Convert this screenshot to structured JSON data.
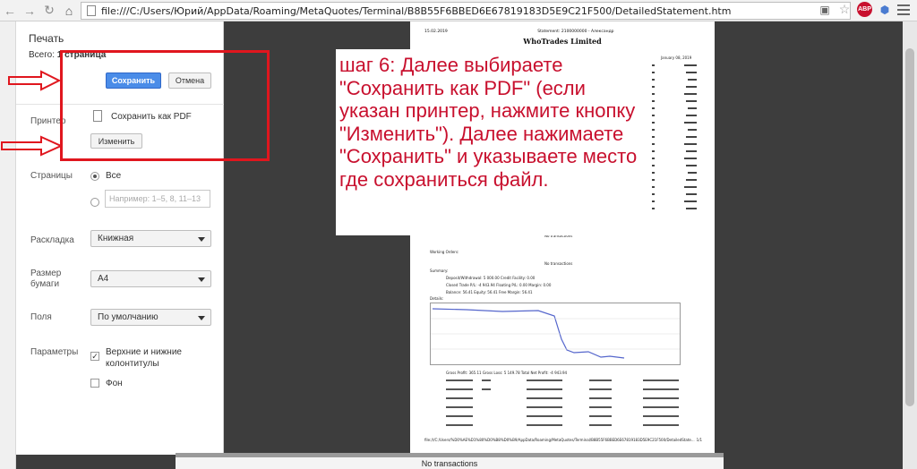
{
  "browser": {
    "url": "file:///C:/Users/Юрий/AppData/Roaming/MetaQuotes/Terminal/B8B55F6BBED6E67819183D5E9C21F500/DetailedStatement.htm",
    "extension_badge": "ABP"
  },
  "print_panel": {
    "title": "Печать",
    "total_label": "Всего:",
    "total_value": "1 страница",
    "save_label": "Сохранить",
    "cancel_label": "Отмена",
    "printer_label": "Принтер",
    "printer_name": "Сохранить как PDF",
    "change_label": "Изменить",
    "pages_label": "Страницы",
    "pages_all": "Все",
    "pages_placeholder": "Например: 1–5, 8, 11–13",
    "layout_label": "Раскладка",
    "layout_value": "Книжная",
    "paper_label_1": "Размер",
    "paper_label_2": "бумаги",
    "paper_value": "A4",
    "margins_label": "Поля",
    "margins_value": "По умолчанию",
    "params_label": "Параметры",
    "headers_label_1": "Верхние и нижние",
    "headers_label_2": "колонтитулы",
    "background_label": "Фон"
  },
  "document": {
    "date_left": "15.02.2019",
    "statement_line": "Statement: 2100000000 - Александр",
    "title": "WhoTrades Limited",
    "date_right": "January 08, 2019",
    "no_transactions_1": "No transactions",
    "working_orders": "Working Orders:",
    "no_transactions_2": "No transactions",
    "summary": "Summary:",
    "deposit_row": "Deposit/Withdrawal:      5 000.00                Credit Facility:        0.00",
    "closed_row": "Closed Trade P/L:      -4 943.94              Floating P/L:        0.00              Margin:        0.00",
    "balance_row": "Balance:         56.41                    Equity:       56.41          Free Margin:      56.41",
    "details": "Details:",
    "gross_row": "Gross Profit:    365.11        Gross Loss:    5 149.78        Total Net Profit:   -4 943.94",
    "footer_path": "file:///C:/Users/%D0%AE%D1%80%D0%B8%D0%B9/AppData/Roaming/MetaQuotes/Terminal/B8B55F6BBED6E67819183D5E9C21F500/DetailedState...",
    "footer_page": "1/1"
  },
  "annotation": {
    "text": "шаг 6: Далее выбираете \"Сохранить как PDF\" (если указан принтер, нажмите кнопку \"Изменить\"). Далее нажимаете \"Сохранить\" и указываете место где сохраниться файл.",
    "color": "#c8102e"
  },
  "bottom": {
    "text": "No transactions"
  }
}
